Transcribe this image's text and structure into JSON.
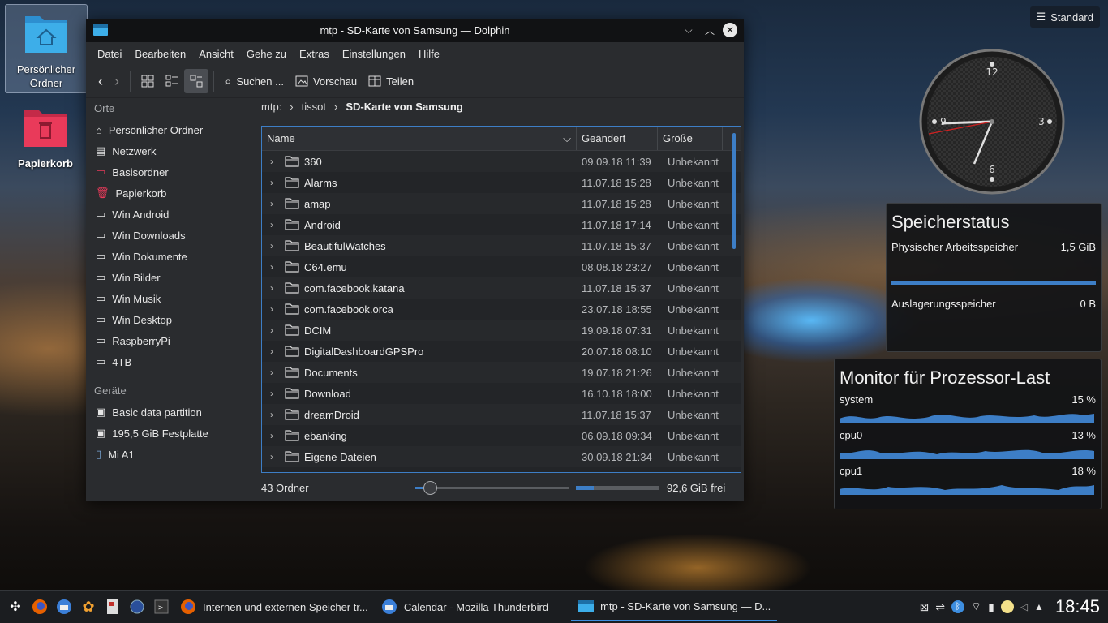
{
  "desktop": {
    "icons": [
      {
        "label_line1": "Persönlicher",
        "label_line2": "Ordner"
      },
      {
        "label_line1": "Papierkorb",
        "label_line2": ""
      }
    ],
    "standard_button": "Standard"
  },
  "window": {
    "title": "mtp - SD-Karte von Samsung — Dolphin",
    "menu": [
      "Datei",
      "Bearbeiten",
      "Ansicht",
      "Gehe zu",
      "Extras",
      "Einstellungen",
      "Hilfe"
    ],
    "toolbar": {
      "search": "Suchen ...",
      "preview": "Vorschau",
      "split": "Teilen"
    },
    "places": {
      "header": "Orte",
      "items": [
        "Persönlicher Ordner",
        "Netzwerk",
        "Basisordner",
        "Papierkorb",
        "Win Android",
        "Win Downloads",
        "Win Dokumente",
        "Win Bilder",
        "Win Musik",
        "Win Desktop",
        "RaspberryPi",
        "4TB"
      ],
      "devices_header": "Geräte",
      "devices": [
        "Basic data partition",
        "195,5 GiB Festplatte",
        "Mi A1"
      ]
    },
    "breadcrumb": [
      "mtp:",
      "tissot",
      "SD-Karte von Samsung"
    ],
    "columns": {
      "name": "Name",
      "modified": "Geändert",
      "size": "Größe"
    },
    "files": [
      {
        "name": "360",
        "date": "09.09.18 11:39",
        "size": "Unbekannt"
      },
      {
        "name": "Alarms",
        "date": "11.07.18 15:28",
        "size": "Unbekannt"
      },
      {
        "name": "amap",
        "date": "11.07.18 15:28",
        "size": "Unbekannt"
      },
      {
        "name": "Android",
        "date": "11.07.18 17:14",
        "size": "Unbekannt"
      },
      {
        "name": "BeautifulWatches",
        "date": "11.07.18 15:37",
        "size": "Unbekannt"
      },
      {
        "name": "C64.emu",
        "date": "08.08.18 23:27",
        "size": "Unbekannt"
      },
      {
        "name": "com.facebook.katana",
        "date": "11.07.18 15:37",
        "size": "Unbekannt"
      },
      {
        "name": "com.facebook.orca",
        "date": "23.07.18 18:55",
        "size": "Unbekannt"
      },
      {
        "name": "DCIM",
        "date": "19.09.18 07:31",
        "size": "Unbekannt"
      },
      {
        "name": "DigitalDashboardGPSPro",
        "date": "20.07.18 08:10",
        "size": "Unbekannt"
      },
      {
        "name": "Documents",
        "date": "19.07.18 21:26",
        "size": "Unbekannt"
      },
      {
        "name": "Download",
        "date": "16.10.18 18:00",
        "size": "Unbekannt"
      },
      {
        "name": "dreamDroid",
        "date": "11.07.18 15:37",
        "size": "Unbekannt"
      },
      {
        "name": "ebanking",
        "date": "06.09.18 09:34",
        "size": "Unbekannt"
      },
      {
        "name": "Eigene Dateien",
        "date": "30.09.18 21:34",
        "size": "Unbekannt"
      }
    ],
    "status": {
      "count": "43 Ordner",
      "free": "92,6 GiB frei"
    }
  },
  "clock_widget": {
    "n12": "12",
    "n3": "3",
    "n6": "6",
    "n9": "9"
  },
  "memory_widget": {
    "title": "Speicherstatus",
    "physical_label": "Physischer Arbeitsspeicher",
    "physical_value": "1,5 GiB",
    "swap_label": "Auslagerungsspeicher",
    "swap_value": "0 B"
  },
  "cpu_widget": {
    "title": "Monitor für Prozessor-Last",
    "rows": [
      {
        "label": "system",
        "value": "15 %"
      },
      {
        "label": "cpu0",
        "value": "13 %"
      },
      {
        "label": "cpu1",
        "value": "18 %"
      }
    ]
  },
  "taskbar": {
    "tasks": [
      "Internen und externen Speicher tr...",
      "Calendar - Mozilla Thunderbird",
      "mtp - SD-Karte von Samsung — D..."
    ],
    "time": "18:45"
  },
  "colors": {
    "accent": "#3d7ec6",
    "folder_blue": "#3daee9",
    "trash_red": "#e93a5a"
  }
}
